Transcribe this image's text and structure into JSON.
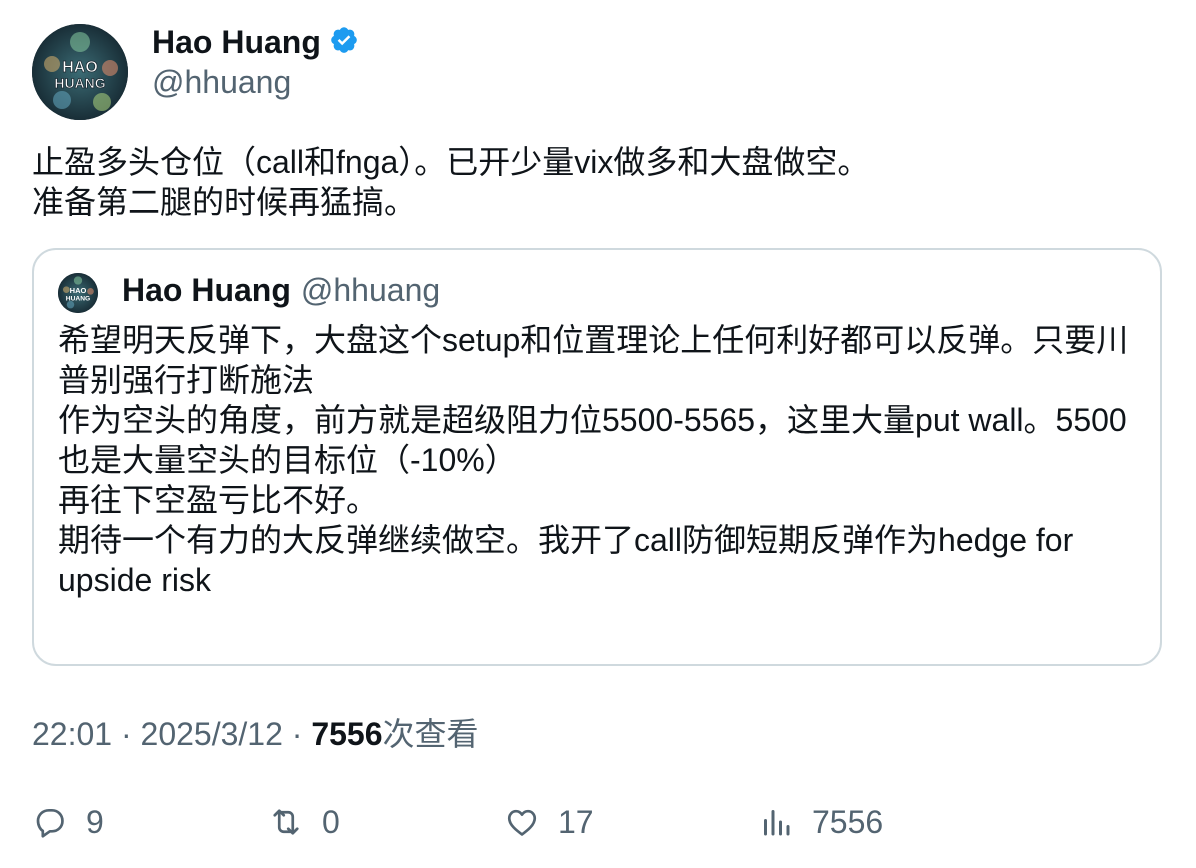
{
  "author": {
    "name": "Hao Huang",
    "handle": "@hhuang",
    "avatar_text": "HAO HUANG",
    "verified": true
  },
  "tweet": {
    "lines": [
      "止盈多头仓位（call和fnga）。已开少量vix做多和大盘做空。",
      "准备第二腿的时候再猛搞。"
    ]
  },
  "quoted": {
    "name": "Hao Huang",
    "handle": "@hhuang",
    "lines": [
      "希望明天反弹下，大盘这个setup和位置理论上任何利好都可以反弹。只要川",
      "普别强行打断施法",
      "作为空头的角度，前方就是超级阻力位5500-5565，这里大量put wall。5500",
      "也是大量空头的目标位（-10%）",
      "再往下空盈亏比不好。",
      "期待一个有力的大反弹继续做空。我开了call防御短期反弹作为hedge for",
      "upside risk"
    ]
  },
  "meta": {
    "time": "22:01",
    "separator": "·",
    "date": "2025/3/12",
    "views_count": "7556",
    "views_label": "次查看"
  },
  "actions": {
    "replies": "9",
    "retweets": "0",
    "likes": "17",
    "views": "7556"
  },
  "colors": {
    "verified": "#1d9bf0",
    "secondary_text": "#536471",
    "border": "#cfd9de"
  },
  "icons": [
    "verified-badge-icon",
    "reply-icon",
    "retweet-icon",
    "like-icon",
    "views-icon"
  ]
}
